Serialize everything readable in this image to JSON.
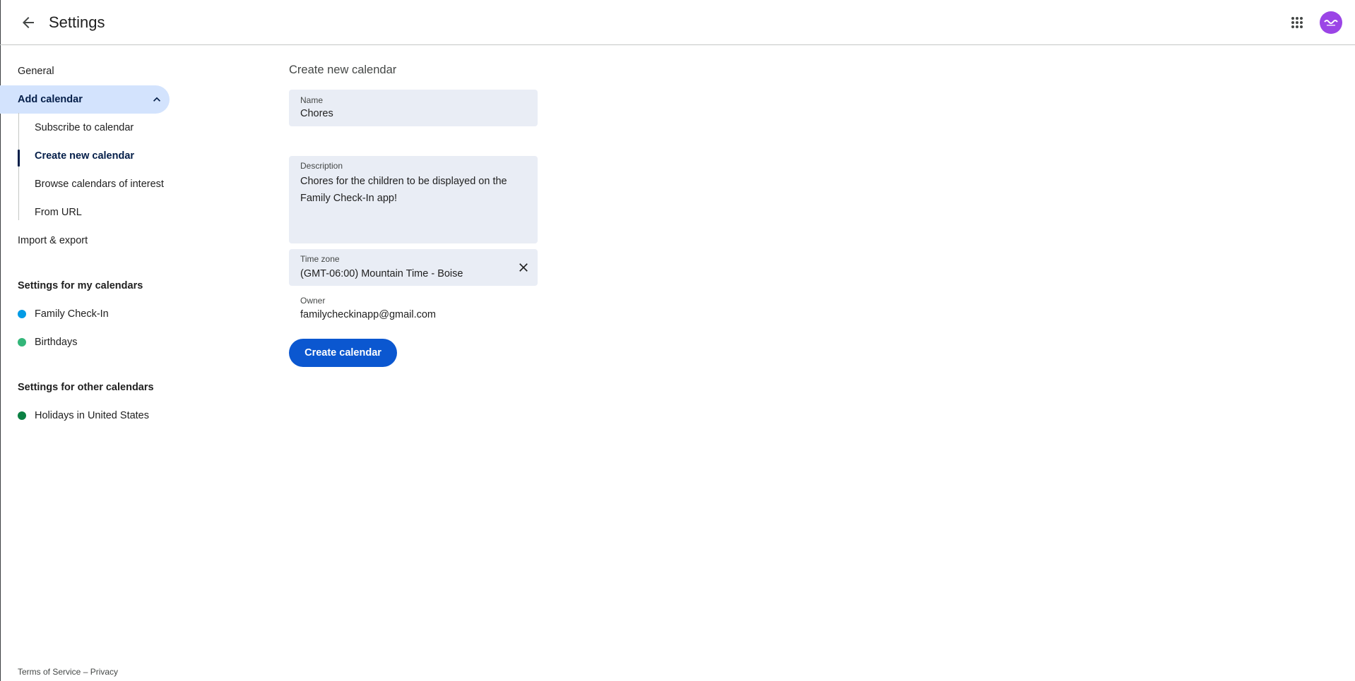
{
  "header": {
    "title": "Settings",
    "back_icon": "arrow-back-icon",
    "apps_icon": "google-apps-grid-icon",
    "avatar_icon": "family-check-in-logo",
    "avatar_color": "#9b45e6"
  },
  "sidebar": {
    "general": "General",
    "add_calendar": "Add calendar",
    "add_calendar_sub": [
      "Subscribe to calendar",
      "Create new calendar",
      "Browse calendars of interest",
      "From URL"
    ],
    "import_export": "Import & export",
    "my_calendars_heading": "Settings for my calendars",
    "my_calendars": [
      {
        "label": "Family Check-In",
        "color": "#039be5"
      },
      {
        "label": "Birthdays",
        "color": "#33b679"
      }
    ],
    "other_calendars_heading": "Settings for other calendars",
    "other_calendars": [
      {
        "label": "Holidays in United States",
        "color": "#0b8043"
      }
    ],
    "accent_color": "#d3e3fd"
  },
  "form": {
    "title": "Create new calendar",
    "name_label": "Name",
    "name_value": "Chores",
    "description_label": "Description",
    "description_value": "Chores for the children to be displayed on the Family Check-In app!",
    "timezone_label": "Time zone",
    "timezone_value": "(GMT-06:00) Mountain Time - Boise",
    "owner_label": "Owner",
    "owner_value": "familycheckinapp@gmail.com",
    "create_button": "Create calendar",
    "button_color": "#0b57d0"
  },
  "footer": {
    "terms": "Terms of Service",
    "separator": " – ",
    "privacy": "Privacy"
  }
}
